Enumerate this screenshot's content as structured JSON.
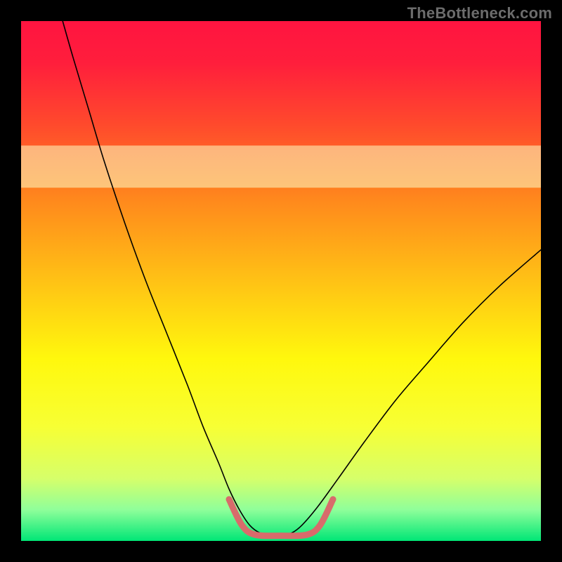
{
  "watermark": "TheBottleneck.com",
  "chart_data": {
    "type": "line",
    "title": "",
    "xlabel": "",
    "ylabel": "",
    "xlim": [
      0,
      100
    ],
    "ylim": [
      0,
      100
    ],
    "gradient_stops": [
      {
        "offset": 0.0,
        "color": "#ff1440"
      },
      {
        "offset": 0.08,
        "color": "#ff1e3c"
      },
      {
        "offset": 0.2,
        "color": "#ff4a2c"
      },
      {
        "offset": 0.35,
        "color": "#ff8b1c"
      },
      {
        "offset": 0.5,
        "color": "#ffc215"
      },
      {
        "offset": 0.65,
        "color": "#fff80d"
      },
      {
        "offset": 0.78,
        "color": "#f7ff34"
      },
      {
        "offset": 0.88,
        "color": "#d6ff6a"
      },
      {
        "offset": 0.94,
        "color": "#8fff9a"
      },
      {
        "offset": 1.0,
        "color": "#00e676"
      }
    ],
    "band_y": 72,
    "band_color": "#fbffc4",
    "series": [
      {
        "name": "bottleneck-curve",
        "stroke": "#000000",
        "stroke_width": 1.6,
        "points": [
          {
            "x": 8.0,
            "y": 100.0
          },
          {
            "x": 10.0,
            "y": 93.0
          },
          {
            "x": 13.0,
            "y": 83.0
          },
          {
            "x": 16.0,
            "y": 73.0
          },
          {
            "x": 20.0,
            "y": 61.0
          },
          {
            "x": 24.0,
            "y": 50.0
          },
          {
            "x": 28.0,
            "y": 40.0
          },
          {
            "x": 32.0,
            "y": 30.0
          },
          {
            "x": 35.0,
            "y": 22.0
          },
          {
            "x": 38.0,
            "y": 15.0
          },
          {
            "x": 40.0,
            "y": 10.0
          },
          {
            "x": 42.0,
            "y": 6.0
          },
          {
            "x": 44.0,
            "y": 3.0
          },
          {
            "x": 46.0,
            "y": 1.5
          },
          {
            "x": 48.0,
            "y": 1.0
          },
          {
            "x": 50.0,
            "y": 1.0
          },
          {
            "x": 52.0,
            "y": 1.5
          },
          {
            "x": 54.0,
            "y": 3.0
          },
          {
            "x": 57.0,
            "y": 6.5
          },
          {
            "x": 61.0,
            "y": 12.0
          },
          {
            "x": 66.0,
            "y": 19.0
          },
          {
            "x": 72.0,
            "y": 27.0
          },
          {
            "x": 78.0,
            "y": 34.0
          },
          {
            "x": 85.0,
            "y": 42.0
          },
          {
            "x": 92.0,
            "y": 49.0
          },
          {
            "x": 100.0,
            "y": 56.0
          }
        ]
      },
      {
        "name": "highlight-bracket",
        "stroke": "#d86b6b",
        "stroke_width": 9,
        "points": [
          {
            "x": 40.0,
            "y": 8.0
          },
          {
            "x": 42.5,
            "y": 3.0
          },
          {
            "x": 45.0,
            "y": 1.2
          },
          {
            "x": 50.0,
            "y": 1.0
          },
          {
            "x": 55.0,
            "y": 1.2
          },
          {
            "x": 57.5,
            "y": 3.0
          },
          {
            "x": 60.0,
            "y": 8.0
          }
        ]
      }
    ]
  }
}
